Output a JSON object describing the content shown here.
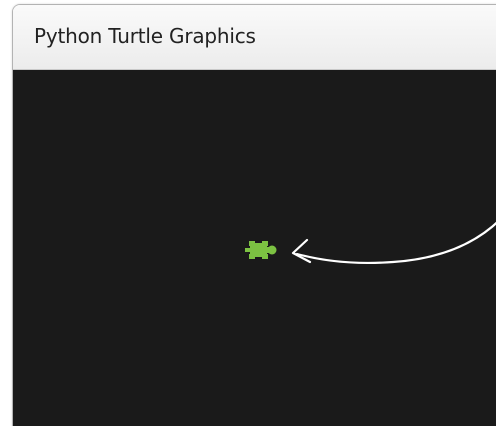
{
  "window": {
    "title": "Python Turtle Graphics"
  },
  "colors": {
    "canvas_background": "#1a1a1a",
    "turtle": "#7cc242",
    "arrow": "#ffffff",
    "titlebar": "#f2f2f2"
  },
  "icons": {
    "turtle": "turtle-icon",
    "annotation": "curved-arrow-icon"
  }
}
